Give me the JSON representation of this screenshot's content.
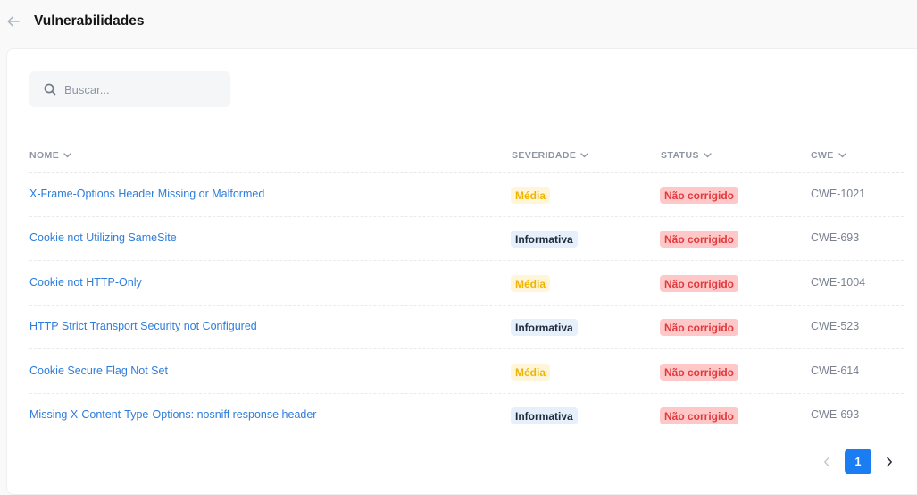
{
  "header": {
    "title": "Vulnerabilidades"
  },
  "search": {
    "placeholder": "Buscar...",
    "value": ""
  },
  "table": {
    "columns": [
      {
        "key": "nome",
        "label": "NOME"
      },
      {
        "key": "severidade",
        "label": "SEVERIDADE"
      },
      {
        "key": "status",
        "label": "STATUS"
      },
      {
        "key": "cwe",
        "label": "CWE"
      }
    ],
    "rows": [
      {
        "nome": "X-Frame-Options Header Missing or Malformed",
        "severidade": "Média",
        "severity_level": "media",
        "status": "Não corrigido",
        "cwe": "CWE-1021"
      },
      {
        "nome": "Cookie not Utilizing SameSite",
        "severidade": "Informativa",
        "severity_level": "info",
        "status": "Não corrigido",
        "cwe": "CWE-693"
      },
      {
        "nome": "Cookie not HTTP-Only",
        "severidade": "Média",
        "severity_level": "media",
        "status": "Não corrigido",
        "cwe": "CWE-1004"
      },
      {
        "nome": "HTTP Strict Transport Security not Configured",
        "severidade": "Informativa",
        "severity_level": "info",
        "status": "Não corrigido",
        "cwe": "CWE-523"
      },
      {
        "nome": "Cookie Secure Flag Not Set",
        "severidade": "Média",
        "severity_level": "media",
        "status": "Não corrigido",
        "cwe": "CWE-614"
      },
      {
        "nome": "Missing X-Content-Type-Options: nosniff response header",
        "severidade": "Informativa",
        "severity_level": "info",
        "status": "Não corrigido",
        "cwe": "CWE-693"
      }
    ]
  },
  "pagination": {
    "current_page": "1",
    "prev_icon": "chevron-left-icon",
    "next_icon": "chevron-right-icon"
  },
  "icons": {
    "back": "arrow-left-icon",
    "search": "search-icon",
    "sort": "chevron-down-icon"
  },
  "colors": {
    "link": "#2e7ddb",
    "media_text": "#f0b400",
    "media_bg": "#fff6d9",
    "info_text": "#1e2b3c",
    "info_bg": "#e6f0fb",
    "status_text": "#e0393e",
    "status_bg": "#ffc8c8",
    "page_active": "#1a7ef2"
  }
}
